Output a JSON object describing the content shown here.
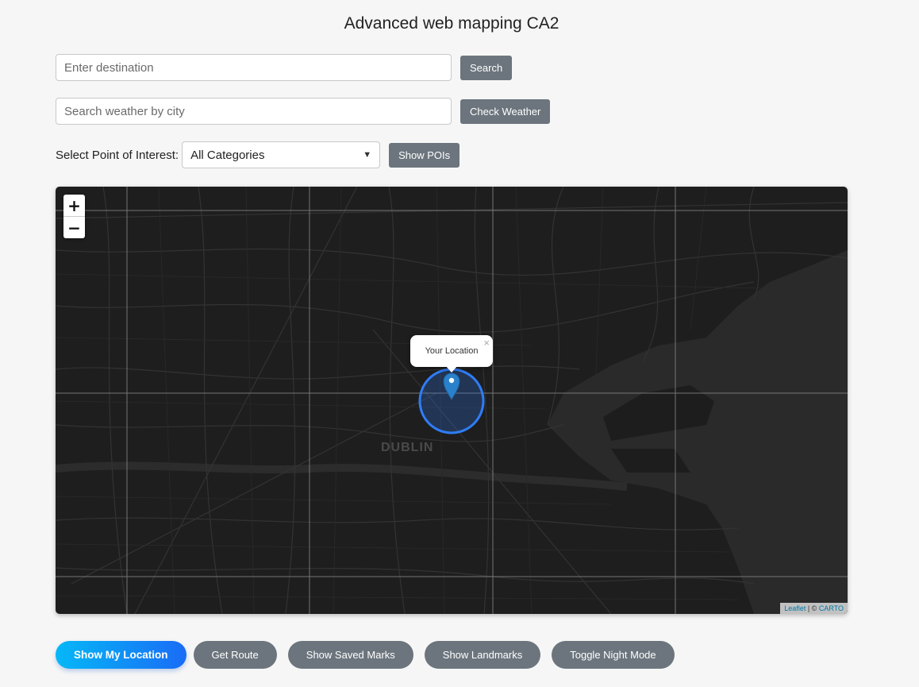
{
  "header": {
    "title": "Advanced web mapping CA2"
  },
  "destination": {
    "placeholder": "Enter destination",
    "button": "Search"
  },
  "weather": {
    "placeholder": "Search weather by city",
    "button": "Check Weather"
  },
  "poi": {
    "label": "Select Point of Interest:",
    "selected": "All Categories",
    "button": "Show POIs"
  },
  "map": {
    "zoom_in": "+",
    "zoom_out": "−",
    "popup_text": "Your Location",
    "popup_close": "×",
    "city_label": "DUBLIN",
    "attribution_leaflet": "Leaflet",
    "attribution_sep": " | © ",
    "attribution_carto": "CARTO",
    "marker_color": "#2a81cb",
    "accuracy_circle_color": "#2f7df6"
  },
  "actions": {
    "show_location": "Show My Location",
    "get_route": "Get Route",
    "saved_marks": "Show Saved Marks",
    "landmarks": "Show Landmarks",
    "night_mode": "Toggle Night Mode"
  }
}
